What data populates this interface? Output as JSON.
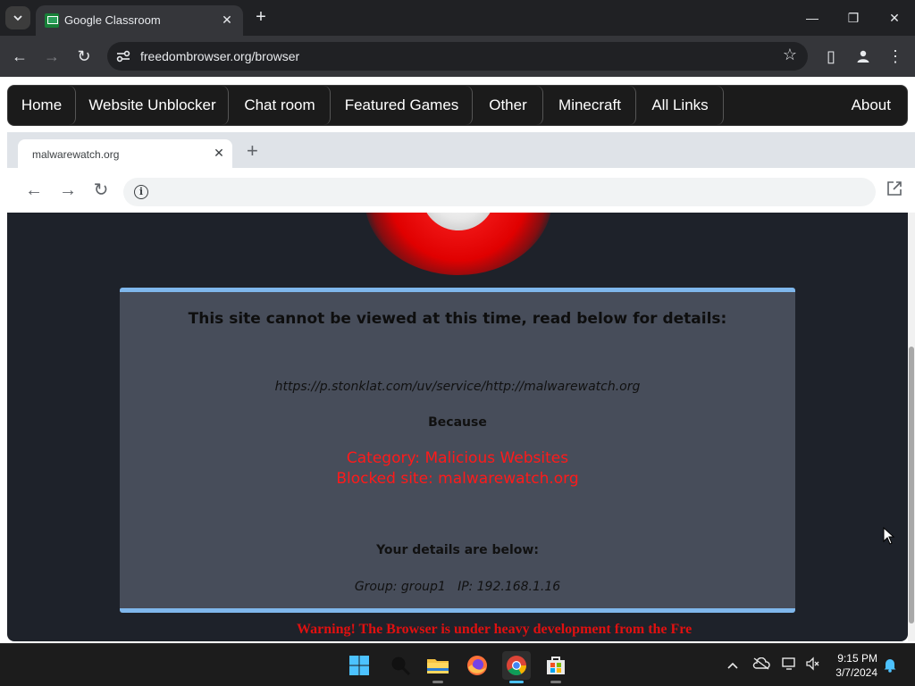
{
  "chrome": {
    "tab_title": "Google Classroom",
    "tab_close": "✕",
    "new_tab": "+",
    "url": "freedombrowser.org/browser",
    "window_controls": {
      "minimize": "—",
      "restore": "❐",
      "close": "✕"
    },
    "toolbar_icons": {
      "back": "←",
      "forward": "→",
      "reload": "↻",
      "star": "☆",
      "sidepanel": "▯",
      "menu": "⋮"
    }
  },
  "site_nav": {
    "items": [
      "Home",
      "Website Unblocker",
      "Chat room",
      "Featured Games",
      "Other",
      "Minecraft",
      "All Links"
    ],
    "about": "About"
  },
  "inner_browser": {
    "tab_title": "malwarewatch.org",
    "tab_close": "✕",
    "new_tab": "+",
    "icons": {
      "back": "←",
      "forward": "→",
      "reload": "↻",
      "info": "i"
    },
    "address_value": ""
  },
  "block_page": {
    "title": "This site cannot be viewed at this time, read below for details:",
    "url": "https://p.stonklat.com/uv/service/http://malwarewatch.org",
    "because": "Because",
    "category": "Category: Malicious Websites",
    "blocked_site": "Blocked site: malwarewatch.org",
    "details_heading": "Your details are below:",
    "group_ip": "Group: group1   IP: 192.168.1.16",
    "warning": "Warning! The Browser is under heavy development from the Fre",
    "accent_color": "#7fb7ec",
    "alert_color": "#ff1a1a"
  },
  "taskbar": {
    "apps": [
      "start-icon",
      "search-icon",
      "file-explorer-icon",
      "firefox-icon",
      "chrome-icon",
      "store-icon"
    ],
    "time": "9:15 PM",
    "date": "3/7/2024"
  }
}
